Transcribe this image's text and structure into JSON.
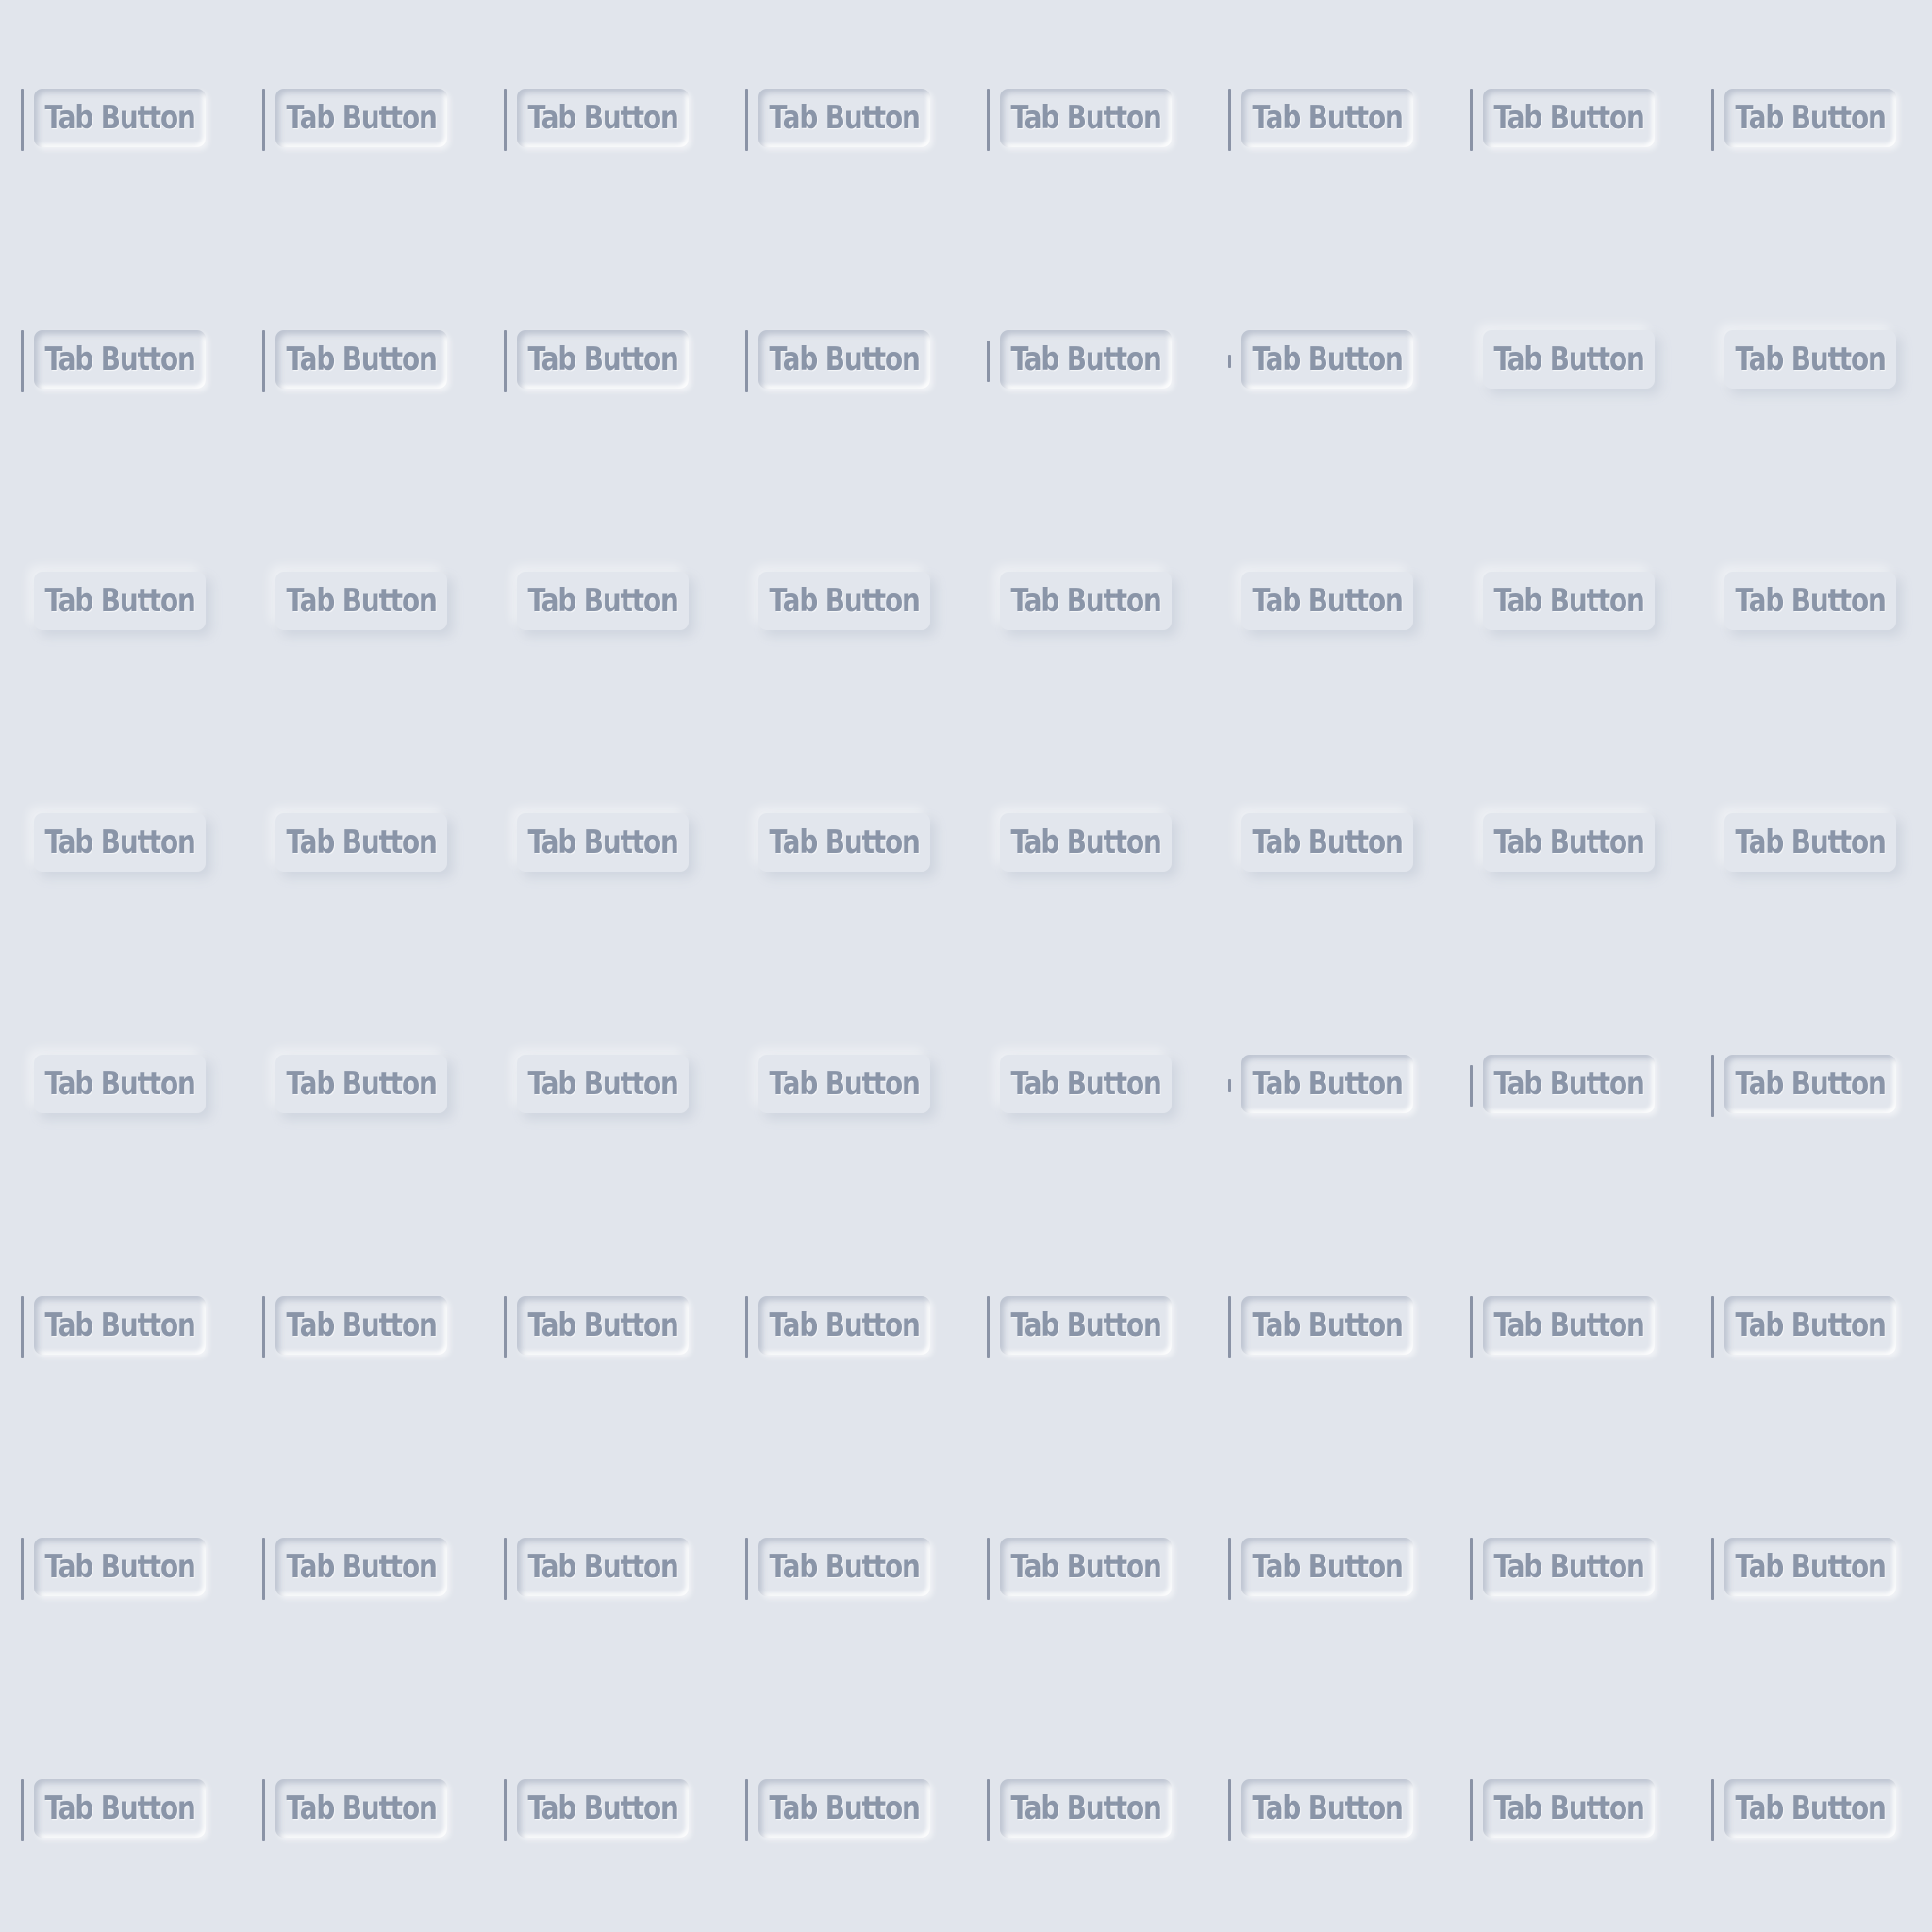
{
  "page": {
    "background": "#e1e5ec"
  },
  "tab_label": "Tab Button",
  "colors": {
    "text": "#8a95a8",
    "indicator": "#8a93a6",
    "surface": "#e2e6ed"
  },
  "grid": {
    "rows": 8,
    "cols": 8,
    "states": [
      [
        "active",
        "active",
        "active",
        "active",
        "active",
        "active",
        "active",
        "active"
      ],
      [
        "active",
        "active",
        "active",
        "active",
        "active-medium",
        "active-small",
        "inactive",
        "inactive"
      ],
      [
        "inactive",
        "inactive",
        "inactive",
        "inactive",
        "inactive",
        "inactive",
        "inactive",
        "inactive"
      ],
      [
        "inactive",
        "inactive",
        "inactive",
        "inactive",
        "inactive",
        "inactive",
        "inactive",
        "inactive"
      ],
      [
        "inactive",
        "inactive",
        "inactive",
        "inactive",
        "inactive",
        "active-small",
        "active-medium",
        "active"
      ],
      [
        "active",
        "active",
        "active",
        "active",
        "active",
        "active",
        "active",
        "active"
      ],
      [
        "active",
        "active",
        "active",
        "active",
        "active",
        "active",
        "active",
        "active"
      ],
      [
        "active",
        "active",
        "active",
        "active",
        "active",
        "active",
        "active",
        "active"
      ]
    ]
  }
}
